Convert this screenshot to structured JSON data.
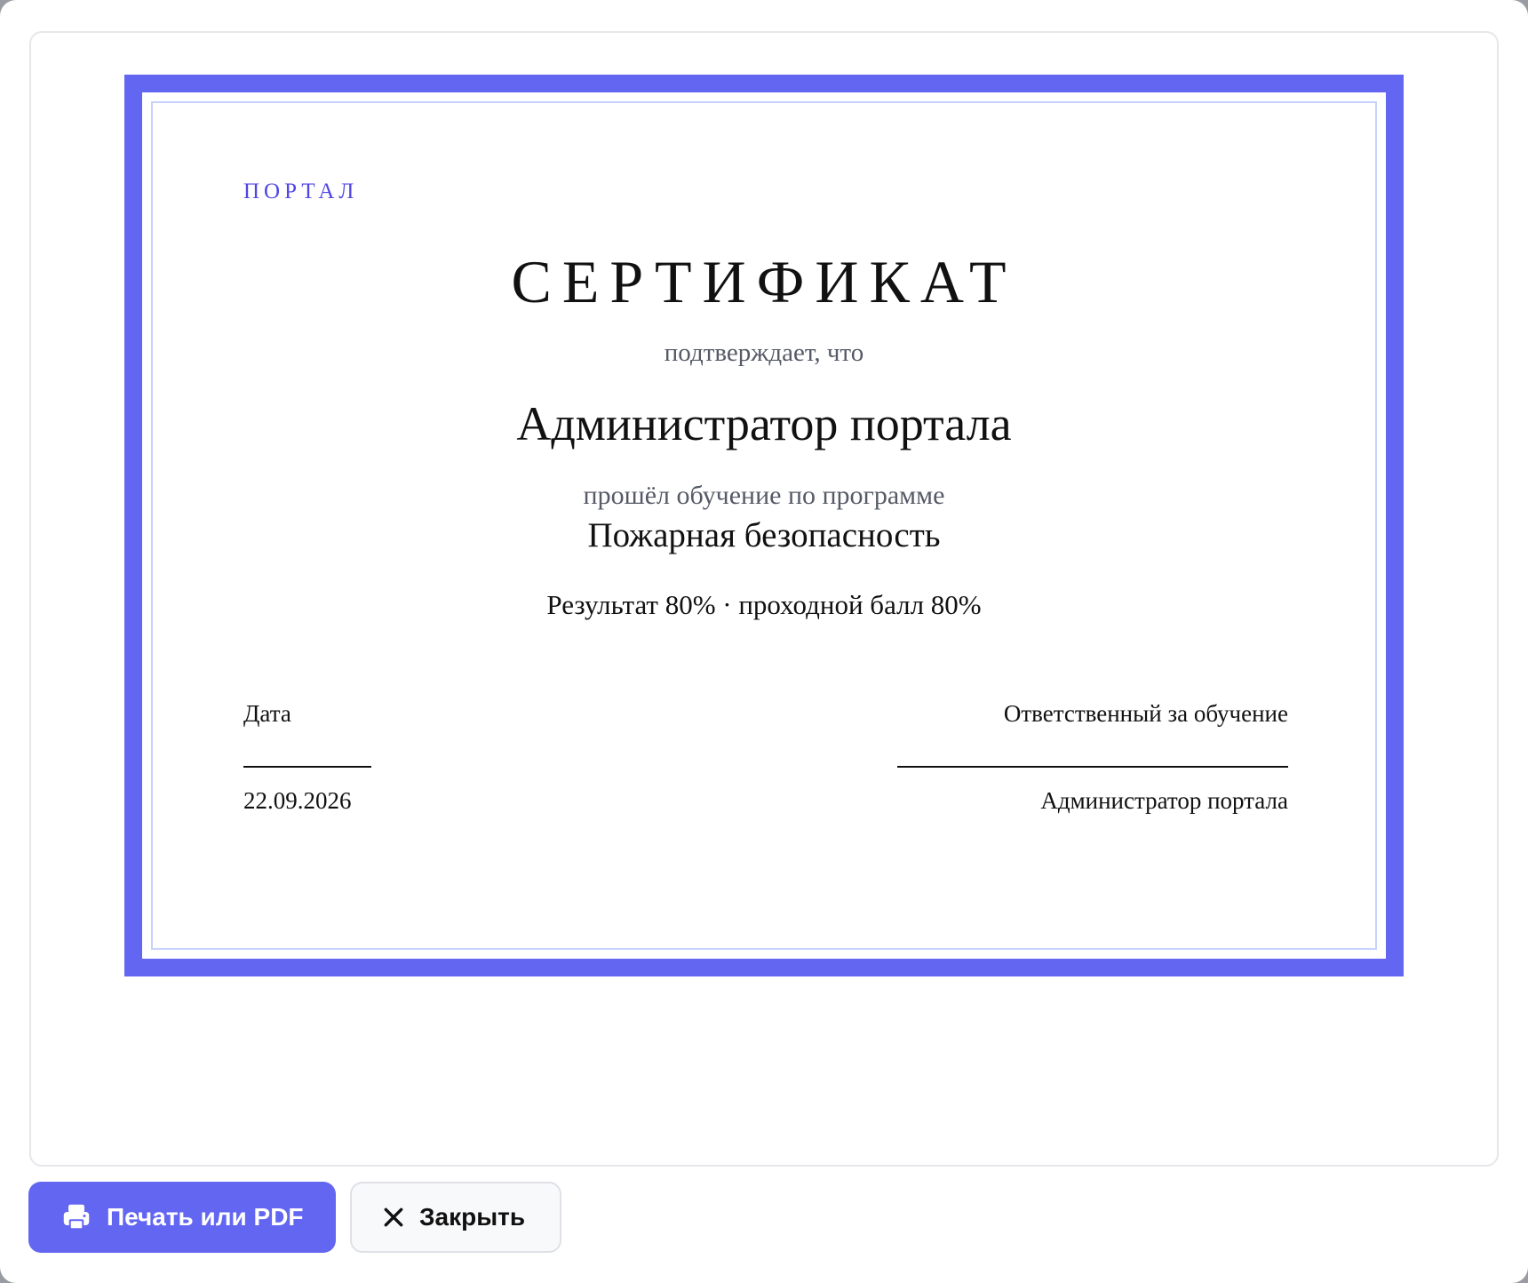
{
  "certificate": {
    "brand": "ПОРТАЛ",
    "title": "СЕРТИФИКАТ",
    "confirms": "подтверждает, что",
    "recipient": "Администратор портала",
    "completed": "прошёл обучение по программе",
    "program": "Пожарная безопасность",
    "result": "Результат 80% · проходной балл 80%",
    "date_label": "Дата",
    "date_value": "22.09.2026",
    "responsible_label": "Ответственный за обучение",
    "responsible_value": "Администратор портала"
  },
  "actions": {
    "print_label": "Печать или PDF",
    "print_icon": "printer-icon",
    "close_label": "Закрыть",
    "close_icon": "close-icon"
  },
  "colors": {
    "accent": "#6366f1",
    "brand_text": "#4f46e5",
    "inner_border": "#c7d2fe"
  }
}
